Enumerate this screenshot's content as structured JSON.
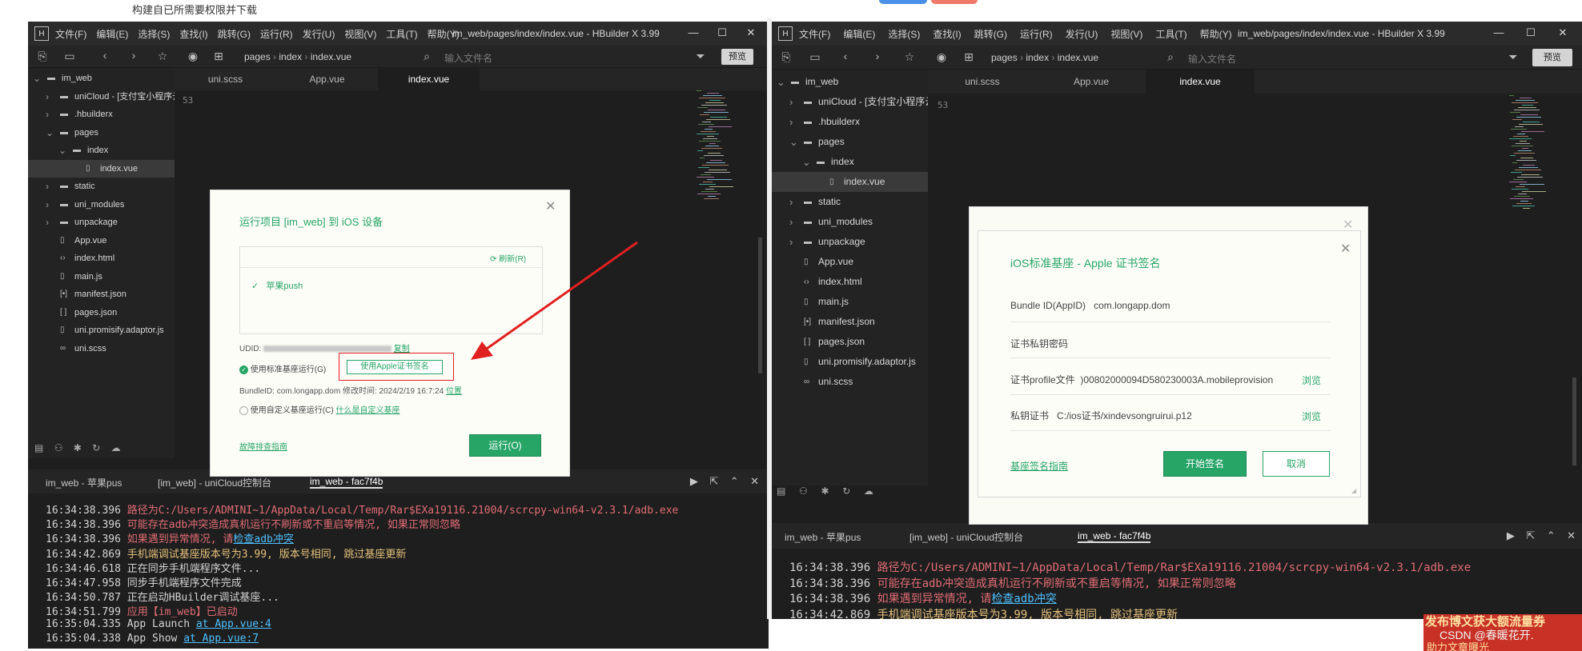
{
  "bg_fragments": {
    "top_text": "构建自已所需要权限并下载"
  },
  "left_window": {
    "title": "im_web/pages/index/index.vue - HBuilder X 3.99",
    "menu": [
      "文件(F)",
      "编辑(E)",
      "选择(S)",
      "查找(I)",
      "跳转(G)",
      "运行(R)",
      "发行(U)",
      "视图(V)",
      "工具(T)",
      "帮助(Y)"
    ],
    "breadcrumb": [
      "pages",
      "index",
      "index.vue"
    ],
    "search_placeholder": "输入文件名",
    "preview_label": "预览",
    "tabs": [
      "uni.scss",
      "App.vue",
      "index.vue"
    ],
    "active_tab": "index.vue",
    "line_number": "53",
    "tree": [
      {
        "label": "im_web",
        "icon": "folder",
        "indent": 0,
        "arrow": "down"
      },
      {
        "label": "uniCloud - [支付宝小程序云]",
        "icon": "folder",
        "indent": 1,
        "arrow": "right",
        "extra": true
      },
      {
        "label": ".hbuilderx",
        "icon": "folder",
        "indent": 1,
        "arrow": "right"
      },
      {
        "label": "pages",
        "icon": "folder",
        "indent": 1,
        "arrow": "down"
      },
      {
        "label": "index",
        "icon": "folder",
        "indent": 2,
        "arrow": "down"
      },
      {
        "label": "index.vue",
        "icon": "file",
        "indent": 3,
        "arrow": "",
        "selected": true
      },
      {
        "label": "static",
        "icon": "folder",
        "indent": 1,
        "arrow": "right"
      },
      {
        "label": "uni_modules",
        "icon": "folder",
        "indent": 1,
        "arrow": "right"
      },
      {
        "label": "unpackage",
        "icon": "folder",
        "indent": 1,
        "arrow": "right"
      },
      {
        "label": "App.vue",
        "icon": "file",
        "indent": 1,
        "arrow": ""
      },
      {
        "label": "index.html",
        "icon": "code",
        "indent": 1,
        "arrow": ""
      },
      {
        "label": "main.js",
        "icon": "file",
        "indent": 1,
        "arrow": ""
      },
      {
        "label": "manifest.json",
        "icon": "json",
        "indent": 1,
        "arrow": ""
      },
      {
        "label": "pages.json",
        "icon": "brackets",
        "indent": 1,
        "arrow": ""
      },
      {
        "label": "uni.promisify.adaptor.js",
        "icon": "file",
        "indent": 1,
        "arrow": ""
      },
      {
        "label": "uni.scss",
        "icon": "link",
        "indent": 1,
        "arrow": ""
      }
    ],
    "console_tabs": [
      "im_web - 苹果pus",
      "[im_web] - uniCloud控制台",
      "im_web - fac7f4b"
    ],
    "logs": [
      {
        "time": "16:34:38.396",
        "parts": [
          {
            "text": "路径为C:/Users/ADMINI~1/AppData/Local/Temp/Rar$EXa19116.21004/scrcpy-win64-v2.3.1/adb.exe",
            "style": "red"
          }
        ]
      },
      {
        "time": "16:34:38.396",
        "parts": [
          {
            "text": "可能存在adb冲突造成真机运行不刷新或不重启等情况, 如果正常则忽略",
            "style": "red"
          }
        ]
      },
      {
        "time": "16:34:38.396",
        "parts": [
          {
            "text": "如果遇到异常情况, 请",
            "style": "red"
          },
          {
            "text": "检查adb冲突",
            "style": "link"
          }
        ]
      },
      {
        "time": "16:34:42.869",
        "parts": [
          {
            "text": "手机端调试基座版本号为3.99, 版本号相同, 跳过基座更新",
            "style": "yellow"
          }
        ]
      },
      {
        "time": "16:34:46.618",
        "parts": [
          {
            "text": "正在同步手机端程序文件...",
            "style": "white"
          }
        ]
      },
      {
        "time": "16:34:47.958",
        "parts": [
          {
            "text": "同步手机端程序文件完成",
            "style": "white"
          }
        ]
      },
      {
        "time": "16:34:50.787",
        "parts": [
          {
            "text": "正在启动HBuilder调试基座...",
            "style": "white"
          }
        ]
      },
      {
        "time": "16:34:51.799",
        "parts": [
          {
            "text": "应用【im_web】已启动",
            "style": "red"
          }
        ]
      },
      {
        "time": "16:35:04.335",
        "parts": [
          {
            "text": "App Launch ",
            "style": "white"
          },
          {
            "text": "at App.vue:4",
            "style": "link"
          }
        ]
      },
      {
        "time": "16:35:04.338",
        "parts": [
          {
            "text": "App Show ",
            "style": "white"
          },
          {
            "text": "at App.vue:7",
            "style": "link"
          }
        ]
      }
    ],
    "dialog": {
      "title": "运行项目 [im_web] 到 iOS 设备",
      "refresh": "刷新(R)",
      "device": "苹果push",
      "udid_label": "UDID:",
      "copy": "复制",
      "standard_base": "使用标准基座运行(G)",
      "apple_sign_button": "使用Apple证书签名",
      "bundle_info": "BundleID: com.longapp.dom  修改时间: 2024/2/19 16:7:24",
      "location": "位置",
      "custom_base": "使用自定义基座运行(C)",
      "what_custom": "什么是自定义基座",
      "troubleshoot": "故障排查指南",
      "run": "运行(O)"
    }
  },
  "right_window": {
    "title": "im_web/pages/index/index.vue - HBuilder X 3.99",
    "menu": [
      "文件(F)",
      "编辑(E)",
      "选择(S)",
      "查找(I)",
      "跳转(G)",
      "运行(R)",
      "发行(U)",
      "视图(V)",
      "工具(T)",
      "帮助(Y)"
    ],
    "breadcrumb": [
      "pages",
      "index",
      "index.vue"
    ],
    "search_placeholder": "输入文件名",
    "preview_label": "预览",
    "tabs": [
      "uni.scss",
      "App.vue",
      "index.vue"
    ],
    "active_tab": "index.vue",
    "line_number": "53",
    "tree": [
      {
        "label": "im_web",
        "icon": "folder",
        "indent": 0,
        "arrow": "down"
      },
      {
        "label": "uniCloud - [支付宝小程序云]",
        "icon": "folder",
        "indent": 1,
        "arrow": "right"
      },
      {
        "label": ".hbuilderx",
        "icon": "folder",
        "indent": 1,
        "arrow": "right"
      },
      {
        "label": "pages",
        "icon": "folder",
        "indent": 1,
        "arrow": "down"
      },
      {
        "label": "index",
        "icon": "folder",
        "indent": 2,
        "arrow": "down"
      },
      {
        "label": "index.vue",
        "icon": "file",
        "indent": 3,
        "arrow": "",
        "selected": true
      },
      {
        "label": "static",
        "icon": "folder",
        "indent": 1,
        "arrow": "right"
      },
      {
        "label": "uni_modules",
        "icon": "folder",
        "indent": 1,
        "arrow": "right"
      },
      {
        "label": "unpackage",
        "icon": "folder",
        "indent": 1,
        "arrow": "right"
      },
      {
        "label": "App.vue",
        "icon": "file",
        "indent": 1,
        "arrow": ""
      },
      {
        "label": "index.html",
        "icon": "code",
        "indent": 1,
        "arrow": ""
      },
      {
        "label": "main.js",
        "icon": "file",
        "indent": 1,
        "arrow": ""
      },
      {
        "label": "manifest.json",
        "icon": "json",
        "indent": 1,
        "arrow": ""
      },
      {
        "label": "pages.json",
        "icon": "brackets",
        "indent": 1,
        "arrow": ""
      },
      {
        "label": "uni.promisify.adaptor.js",
        "icon": "file",
        "indent": 1,
        "arrow": ""
      },
      {
        "label": "uni.scss",
        "icon": "link",
        "indent": 1,
        "arrow": ""
      }
    ],
    "console_tabs": [
      "im_web - 苹果pus",
      "[im_web] - uniCloud控制台",
      "im_web - fac7f4b"
    ],
    "logs": [
      {
        "time": "16:34:38.396",
        "parts": [
          {
            "text": "路径为C:/Users/ADMINI~1/AppData/Local/Temp/Rar$EXa19116.21004/scrcpy-win64-v2.3.1/adb.exe",
            "style": "red"
          }
        ]
      },
      {
        "time": "16:34:38.396",
        "parts": [
          {
            "text": "可能存在adb冲突造成真机运行不刷新或不重启等情况, 如果正常则忽略",
            "style": "red"
          }
        ]
      },
      {
        "time": "16:34:38.396",
        "parts": [
          {
            "text": "如果遇到异常情况, 请",
            "style": "red"
          },
          {
            "text": "检查adb冲突",
            "style": "link"
          }
        ]
      },
      {
        "time": "16:34:42.869",
        "parts": [
          {
            "text": "手机端调试基座版本号为3.99, 版本号相同, 跳过基座更新",
            "style": "yellow"
          }
        ]
      }
    ],
    "dialog": {
      "title": "iOS标准基座 - Apple 证书签名",
      "bundle_label": "Bundle ID(AppID)",
      "bundle_value": "com.longapp.dom",
      "password_label": "证书私钥密码",
      "profile_label": "证书profile文件",
      "profile_value": ")00802000094D580230003A.mobileprovision",
      "browse": "浏览",
      "key_label": "私钥证书",
      "key_value": "C:/ios证书/xindevsongruirui.p12",
      "guide": "基座签名指南",
      "start": "开始签名",
      "cancel": "取消"
    }
  },
  "watermark": {
    "line1": "发布博文获大额流量券",
    "line2": "CSDN @春暖花开.",
    "line3": "助力文章曝光"
  },
  "colors": {
    "accent_green": "#27a567",
    "annotation_red": "#e02020"
  }
}
